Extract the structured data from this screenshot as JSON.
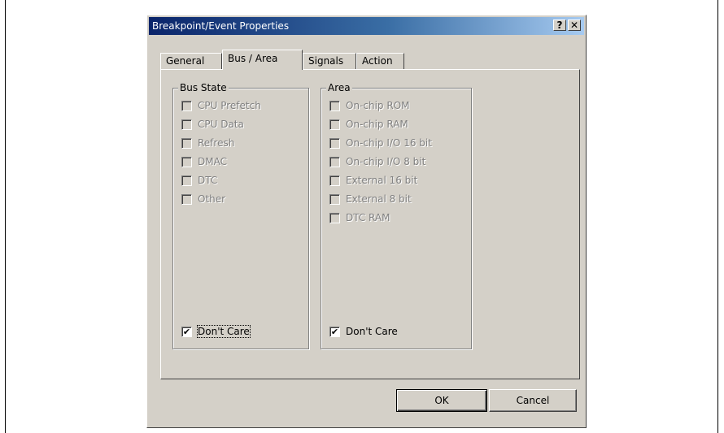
{
  "dialog": {
    "title": "Breakpoint/Event Properties",
    "help_button": "?",
    "close_button": "✕"
  },
  "tabs": [
    "General",
    "Bus / Area",
    "Signals",
    "Action"
  ],
  "active_tab": "Bus / Area",
  "bus_state": {
    "legend": "Bus State",
    "items": [
      {
        "label": "CPU Prefetch",
        "checked": false,
        "enabled": false
      },
      {
        "label": "CPU Data",
        "checked": false,
        "enabled": false
      },
      {
        "label": "Refresh",
        "checked": false,
        "enabled": false
      },
      {
        "label": "DMAC",
        "checked": false,
        "enabled": false
      },
      {
        "label": "DTC",
        "checked": false,
        "enabled": false
      },
      {
        "label": "Other",
        "checked": false,
        "enabled": false
      }
    ],
    "dont_care": {
      "label": "Don't Care",
      "checked": true
    }
  },
  "area": {
    "legend": "Area",
    "items": [
      {
        "label": "On-chip ROM",
        "checked": false,
        "enabled": false
      },
      {
        "label": "On-chip RAM",
        "checked": false,
        "enabled": false
      },
      {
        "label": "On-chip I/O 16 bit",
        "checked": false,
        "enabled": false
      },
      {
        "label": "On-chip I/O 8 bit",
        "checked": false,
        "enabled": false
      },
      {
        "label": "External 16 bit",
        "checked": false,
        "enabled": false
      },
      {
        "label": "External 8 bit",
        "checked": false,
        "enabled": false
      },
      {
        "label": "DTC RAM",
        "checked": false,
        "enabled": false
      }
    ],
    "dont_care": {
      "label": "Don't Care",
      "checked": true
    }
  },
  "buttons": {
    "ok": "OK",
    "cancel": "Cancel"
  },
  "check_mark": "✔"
}
